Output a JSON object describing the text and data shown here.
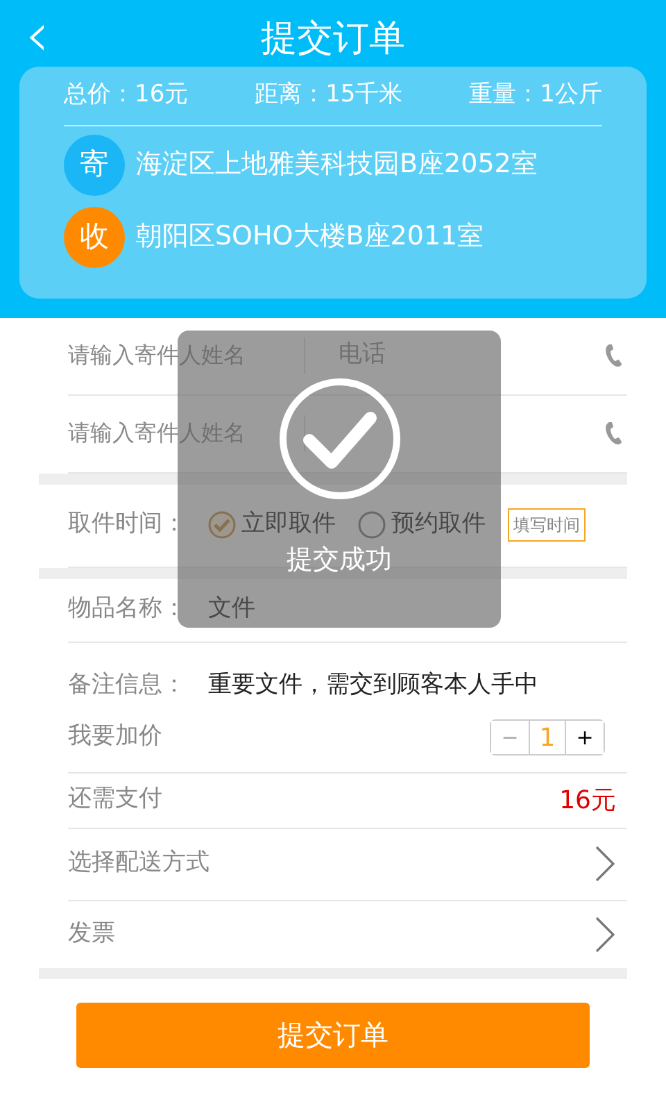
{
  "header": {
    "back": "‹",
    "title": "提交订单"
  },
  "summary": {
    "stats": [
      "总价：16元",
      "距离：15千米",
      "重量：1公斤"
    ],
    "addresses": [
      {
        "badge": "寄",
        "text": "海淀区上地雅美科技园B座2052室",
        "color": "#1ab6f5"
      },
      {
        "badge": "收",
        "text": "朝阳区SOHO大楼B座2011室",
        "color": "#ff8a00"
      }
    ]
  },
  "contacts": [
    {
      "name_placeholder": "请输入寄件人姓名",
      "phone_placeholder": "电话"
    },
    {
      "name_placeholder": "请输入寄件人姓名"
    }
  ],
  "pickup": {
    "label": "取件时间：",
    "options": [
      {
        "label": "立即取件",
        "selected": true
      },
      {
        "label": "预约取件",
        "selected": false
      }
    ],
    "time_button": "填写时间"
  },
  "item": {
    "label": "物品名称：",
    "value": "文件"
  },
  "remark": {
    "label": "备注信息：",
    "value": "重要文件，需交到顾客本人手中"
  },
  "bid": {
    "label": "我要加价",
    "minus": "−",
    "value": "1",
    "plus": "+"
  },
  "payment": {
    "label": "还需支付",
    "amount": "16元"
  },
  "links": [
    "选择配送方式",
    "发票"
  ],
  "submit_button": "提交订单",
  "toast": {
    "message": "提交成功"
  }
}
